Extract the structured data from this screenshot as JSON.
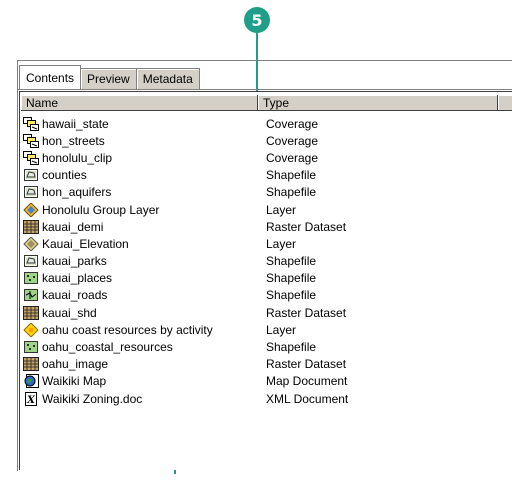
{
  "callout": {
    "number": "5",
    "color": "#1f9e89"
  },
  "tabs": [
    {
      "label": "Contents",
      "active": true
    },
    {
      "label": "Preview",
      "active": false
    },
    {
      "label": "Metadata",
      "active": false
    }
  ],
  "columns": {
    "name": "Name",
    "type": "Type"
  },
  "rows": [
    {
      "name": "hawaii_state",
      "type": "Coverage",
      "icon": "coverage-icon"
    },
    {
      "name": "hon_streets",
      "type": "Coverage",
      "icon": "coverage-icon"
    },
    {
      "name": "honolulu_clip",
      "type": "Coverage",
      "icon": "coverage-icon"
    },
    {
      "name": "counties",
      "type": "Shapefile",
      "icon": "polygon-shapefile-icon"
    },
    {
      "name": "hon_aquifers",
      "type": "Shapefile",
      "icon": "polygon-shapefile-icon"
    },
    {
      "name": "Honolulu Group Layer",
      "type": "Layer",
      "icon": "group-layer-icon"
    },
    {
      "name": "kauai_demi",
      "type": "Raster Dataset",
      "icon": "raster-icon"
    },
    {
      "name": "Kauai_Elevation",
      "type": "Layer",
      "icon": "layer-icon"
    },
    {
      "name": "kauai_parks",
      "type": "Shapefile",
      "icon": "polygon-shapefile-icon"
    },
    {
      "name": "kauai_places",
      "type": "Shapefile",
      "icon": "point-shapefile-icon"
    },
    {
      "name": "kauai_roads",
      "type": "Shapefile",
      "icon": "line-shapefile-icon"
    },
    {
      "name": "kauai_shd",
      "type": "Raster Dataset",
      "icon": "raster-icon"
    },
    {
      "name": "oahu coast resources by activity",
      "type": "Layer",
      "icon": "yellow-layer-icon"
    },
    {
      "name": "oahu_coastal_resources",
      "type": "Shapefile",
      "icon": "point-shapefile-icon"
    },
    {
      "name": "oahu_image",
      "type": "Raster Dataset",
      "icon": "raster-icon"
    },
    {
      "name": "Waikiki Map",
      "type": "Map Document",
      "icon": "map-document-icon"
    },
    {
      "name": "Waikiki Zoning.doc",
      "type": "XML Document",
      "icon": "xml-document-icon"
    }
  ]
}
